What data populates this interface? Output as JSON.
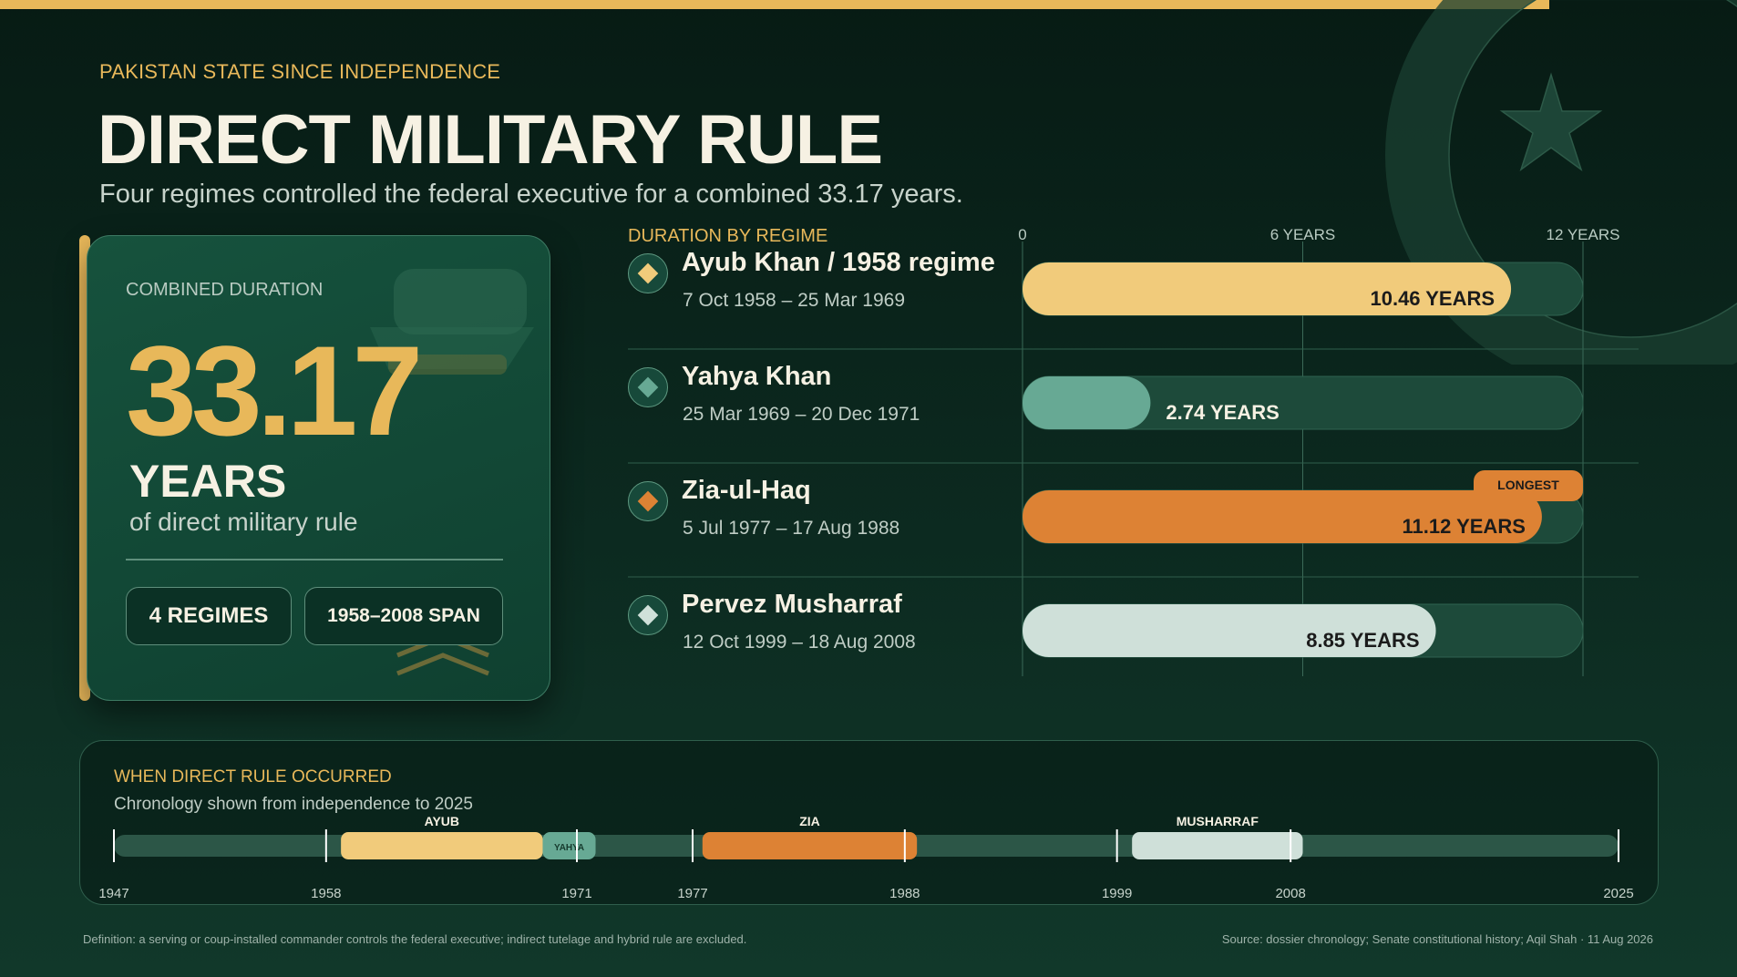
{
  "kicker": "PAKISTAN STATE SINCE INDEPENDENCE",
  "title": "DIRECT MILITARY RULE",
  "subtitle": "Four regimes controlled the federal executive for a combined 33.17 years.",
  "summary_card": {
    "label": "COMBINED DURATION",
    "number": "33.17",
    "unit": "YEARS",
    "caption": "of direct military rule",
    "regimes_pill": "4 REGIMES",
    "span_pill": "1958–2008 SPAN"
  },
  "duration_section_label": "DURATION BY REGIME",
  "timeline_section": {
    "label": "WHEN DIRECT RULE OCCURRED",
    "subtitle": "Chronology shown from independence to 2025"
  },
  "footer": {
    "definition": "Definition: a serving or coup-installed commander controls the federal executive; indirect tutelage and hybrid rule are excluded.",
    "source": "Source: dossier chronology; Senate constitutional history; Aqil Shah · 11 Aug 2026"
  },
  "colors": {
    "background": "#0c2a20",
    "gold": "#e8b85a",
    "ayub": "#f1cb7b",
    "yahya": "#67a994",
    "zia": "#dd8234",
    "musharraf": "#cfe0d9",
    "track": "#1d4a3a"
  },
  "icons": {
    "regime_marker": "diamond-icon",
    "flag": "crescent-star-icon",
    "card_decoration": "military-cap-icon"
  },
  "chart_data": [
    {
      "type": "bar",
      "orientation": "horizontal",
      "title": "DURATION BY REGIME",
      "categories": [
        "Ayub Khan / 1958 regime",
        "Yahya Khan",
        "Zia-ul-Haq",
        "Pervez Musharraf"
      ],
      "date_ranges": [
        "7 Oct 1958 – 25 Mar 1969",
        "25 Mar 1969 – 20 Dec 1971",
        "5 Jul 1977 – 17 Aug 1988",
        "12 Oct 1999 – 18 Aug 2008"
      ],
      "values": [
        10.46,
        2.74,
        11.12,
        8.85
      ],
      "value_labels": [
        "10.46 YEARS",
        "2.74 YEARS",
        "11.12 YEARS",
        "8.85 YEARS"
      ],
      "colors": [
        "#f1cb7b",
        "#67a994",
        "#dd8234",
        "#cfe0d9"
      ],
      "xlim": [
        0,
        12
      ],
      "x_ticks": [
        0,
        6,
        12
      ],
      "x_tick_labels": [
        "0",
        "6 YEARS",
        "12 YEARS"
      ],
      "highlight": {
        "category": "Zia-ul-Haq",
        "label": "LONGEST"
      },
      "grid": true
    },
    {
      "type": "timeline",
      "title": "WHEN DIRECT RULE OCCURRED",
      "xlim": [
        1947,
        2025
      ],
      "periods": [
        {
          "label": "AYUB",
          "start": 1958.77,
          "end": 1969.23,
          "color": "#f1cb7b"
        },
        {
          "label": "YAHYA",
          "start": 1969.23,
          "end": 1971.97,
          "color": "#67a994"
        },
        {
          "label": "ZIA",
          "start": 1977.51,
          "end": 1988.63,
          "color": "#dd8234"
        },
        {
          "label": "MUSHARRAF",
          "start": 1999.78,
          "end": 2008.63,
          "color": "#cfe0d9"
        }
      ],
      "ticks": [
        1947,
        1958,
        1971,
        1977,
        1988,
        1999,
        2008,
        2025
      ]
    }
  ]
}
